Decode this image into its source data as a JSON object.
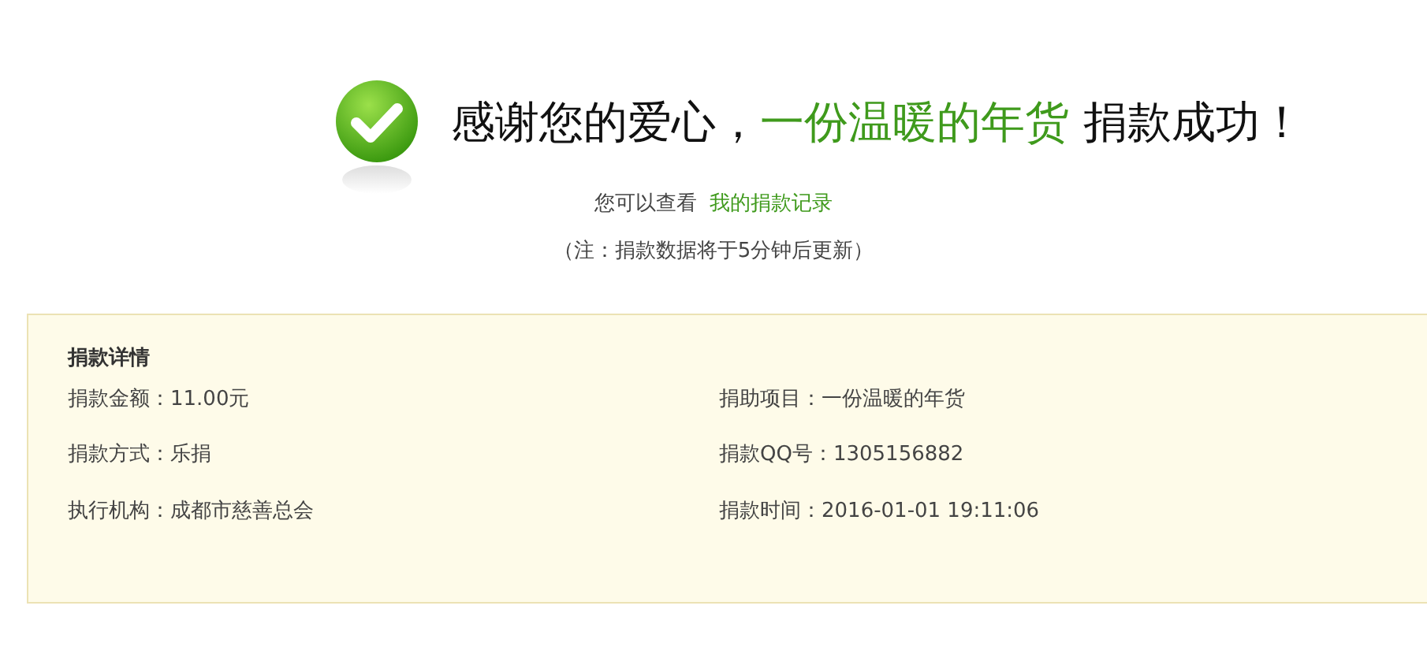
{
  "headline": [
    {
      "text": "感谢您的爱心，",
      "kind": "plain"
    },
    {
      "text": "一份温暖的年货",
      "kind": "highlight"
    },
    {
      "text": " 捐款成功！",
      "kind": "plain"
    }
  ],
  "record_line": {
    "prefix": "您可以查看",
    "link": "我的捐款记录"
  },
  "note": "（注：捐款数据将于5分钟后更新）",
  "details": {
    "title": "捐款详情",
    "rows": [
      {
        "label": "捐款金额：",
        "value": "11.00元"
      },
      {
        "label": "捐助项目：",
        "value": "一份温暖的年货"
      },
      {
        "label": "捐款方式：",
        "value": "乐捐"
      },
      {
        "label": "捐款QQ号：",
        "value": "1305156882"
      },
      {
        "label": "执行机构：",
        "value": "成都市慈善总会"
      },
      {
        "label": "捐款时间：",
        "value": "2016-01-01 19:11:06"
      }
    ]
  }
}
